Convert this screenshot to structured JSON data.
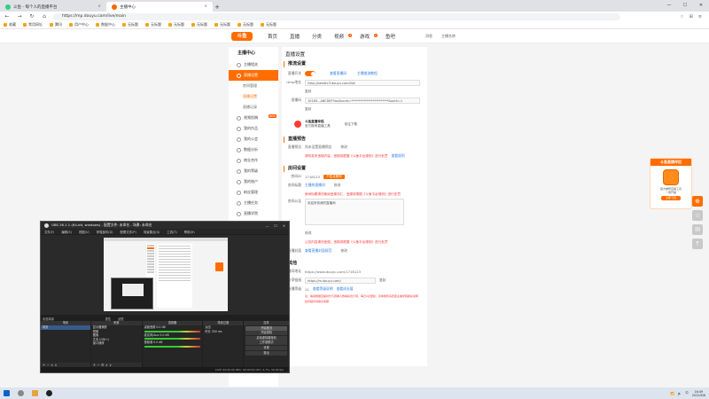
{
  "browser": {
    "tabs": [
      {
        "label": "斗鱼 - 每个人的直播平台",
        "active": false
      },
      {
        "label": "主播中心",
        "active": true
      }
    ],
    "url": "https://mp.douyu.com/live/main",
    "bookmarks": [
      "收藏",
      "常用网址",
      "腾讯",
      "用户中心",
      "数据中心",
      "无标题",
      "无标题",
      "无标题",
      "无标题",
      "无标题",
      "无标题",
      "无标题"
    ]
  },
  "site": {
    "logo": "斗鱼",
    "nav": [
      "首页",
      "直播",
      "分类",
      "视频",
      "游戏",
      "鱼吧"
    ],
    "nav_badges": {
      "视频": "3",
      "游戏": "1"
    },
    "header_right": [
      "消息",
      "主播名称"
    ]
  },
  "sidebar": {
    "title": "主播中心",
    "items": [
      {
        "label": "主播相关",
        "active": false,
        "sub": false
      },
      {
        "label": "直播设置",
        "active": true,
        "sub": false
      },
      {
        "label": "房间管理",
        "active": false,
        "sub": true
      },
      {
        "label": "直播设置",
        "active": false,
        "sub": true,
        "highlight": true
      },
      {
        "label": "直播记录",
        "active": false,
        "sub": true
      },
      {
        "label": "视频投稿",
        "active": false,
        "sub": false,
        "tag": "NEW"
      },
      {
        "label": "我的作品",
        "active": false,
        "sub": false
      },
      {
        "label": "我的公会",
        "active": false,
        "sub": false
      },
      {
        "label": "数据分析",
        "active": false,
        "sub": false
      },
      {
        "label": "商业合作",
        "active": false,
        "sub": false
      },
      {
        "label": "我的等级",
        "active": false,
        "sub": false
      },
      {
        "label": "我的账户",
        "active": false,
        "sub": false
      },
      {
        "label": "粉丝管理",
        "active": false,
        "sub": false
      },
      {
        "label": "主播任务",
        "active": false,
        "sub": false
      },
      {
        "label": "直播学院",
        "active": false,
        "sub": false
      }
    ]
  },
  "content": {
    "page_title": "直播设置",
    "stream": {
      "section": "推流设置",
      "toggle_label": "直播开关",
      "links": [
        "查看直播间",
        "主播推流教程"
      ],
      "rtmp_label": "rtmp地址",
      "rtmp_value": "rtmp://sendtc3.douyu.com/live",
      "code_label": "直播码",
      "code_value": "10185...ABCDEF?wsSecret=************************&auth=1",
      "copy_btn": "复制",
      "copy_btn2": "复制",
      "promo_title": "斗鱼直播伴侣",
      "promo_sub": "官方推荐直播工具",
      "promo_btn": "前往下载"
    },
    "preview": {
      "section": "直播预告",
      "label": "直播预告",
      "value": "尚未设置直播预告",
      "edit": "修改",
      "warn": "请勿发布违规内容，违规将根据《斗鱼平台规则》进行处罚",
      "link": "查看规则"
    },
    "room": {
      "section": "房间设置",
      "id_label": "房间ID",
      "id_value": "1718123",
      "id_btn": "个性化靓号",
      "name_label": "房间标题",
      "name_value": "主播的直播间",
      "name_edit": "修改",
      "name_warn": "房间标题请勿使用违规词汇，违规将根据《斗鱼平台规则》进行处罚",
      "notice_label": "房间公告",
      "notice_value": "欢迎来到我的直播间",
      "notice_edit": "修改",
      "notice_warn": "公告内容请勿违规，违规将根据《斗鱼平台规则》进行处罚",
      "cover_label": "直播封面",
      "cover_link": "查看直播封面规范",
      "cover_edit": "修改"
    },
    "extra": {
      "section": "其他",
      "url_label": "直播间地址",
      "url_value": "https://www.douyu.com/1718123",
      "share_label": "分享链接",
      "share_value": "https://m.douyu.com/",
      "share_btn": "复制",
      "level_label": "直播等级",
      "level_value": "11",
      "level_links": [
        "查看等级说明",
        "查看成长值"
      ],
      "note_red": "注：等级根据直播时长与观看人数等综合计算，每日0点更新，具体规则请查阅主播学院相关说明",
      "note_red2": "如有疑问请联系客服"
    }
  },
  "float_widget": {
    "title": "斗鱼直播伴侣",
    "desc": "官方推荐直播工具",
    "desc2": "一键开播",
    "btn": "立即下载",
    "side_buttons": [
      "⊕",
      "☆",
      "✉",
      "↑"
    ]
  },
  "obs": {
    "title": "OBS 26.1.1 (64-bit, windows) - 配置文件: 未命名 - 场景: 未命名",
    "menu": [
      "文件(F)",
      "编辑(E)",
      "视图(V)",
      "停靠部件(D)",
      "配置文件(P)",
      "场景集合(S)",
      "工具(T)",
      "帮助(H)"
    ],
    "status_items": [
      "未选择源",
      "属性",
      "滤镜"
    ],
    "scenes_title": "场景",
    "scenes": [
      "场景"
    ],
    "sources_title": "来源",
    "sources": [
      "显示器捕获",
      "视频",
      "图像",
      "文本 (GDI+)",
      "窗口捕获"
    ],
    "mixer_title": "混音器",
    "mixer": [
      {
        "label": "桌面音频",
        "level": "0.0 dB"
      },
      {
        "label": "麦克风/Aux",
        "level": "0.0 dB"
      },
      {
        "label": "音频源",
        "level": "0.0 dB"
      }
    ],
    "transitions_title": "场景过渡",
    "transition_value": "淡出",
    "transition_duration": "300 ms",
    "transition_dur_label": "时长",
    "controls_title": "控件",
    "controls": [
      "开始推流",
      "开始录制",
      "启动虚拟摄像机",
      "工作室模式",
      "设置",
      "退出"
    ],
    "statusbar": "LIVE: 00:00:00   REC: 00:00:00   CPU: 2.7%, 30.00 fps"
  },
  "taskbar": {
    "time": "16:49",
    "date": "2022/6/8",
    "tray_text": "中"
  },
  "colors": {
    "accent": "#ff6d00",
    "link": "#2b7de9",
    "warn": "#ff3333"
  }
}
